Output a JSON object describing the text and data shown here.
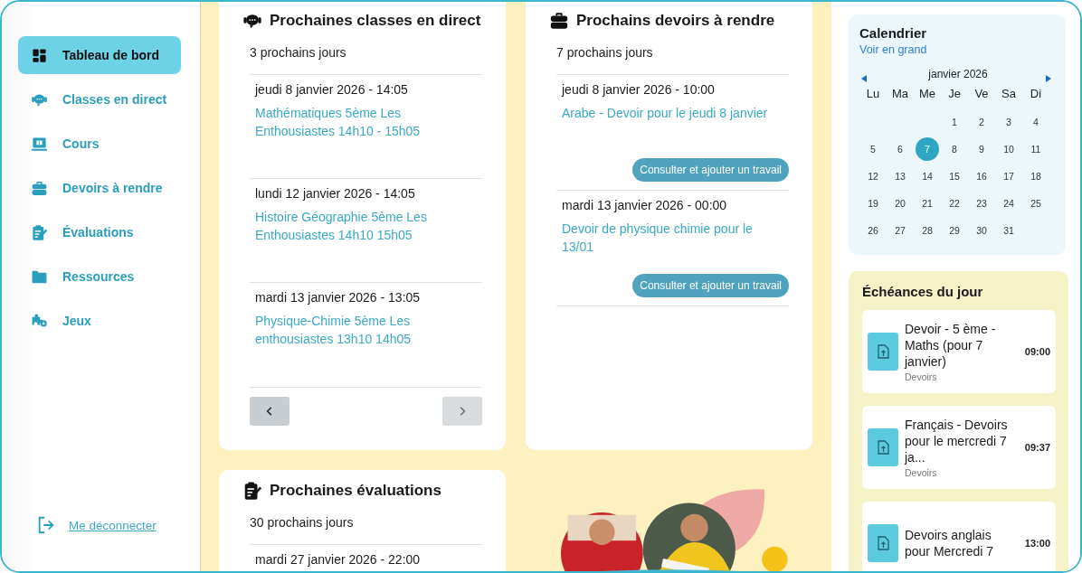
{
  "sidebar": {
    "items": [
      {
        "label": "Tableau de bord",
        "kind": "dashboard",
        "selected": true
      },
      {
        "label": "Classes en direct",
        "kind": "live",
        "selected": false
      },
      {
        "label": "Cours",
        "kind": "courses",
        "selected": false
      },
      {
        "label": "Devoirs à rendre",
        "kind": "homework",
        "selected": false
      },
      {
        "label": "Évaluations",
        "kind": "evaluations",
        "selected": false
      },
      {
        "label": "Ressources",
        "kind": "resources",
        "selected": false
      },
      {
        "label": "Jeux",
        "kind": "games",
        "selected": false
      }
    ],
    "logout": "Me déconnecter"
  },
  "panels": [
    {
      "title": "Prochaines classes en direct",
      "kind": "live",
      "period": "3 prochains jours",
      "entries": [
        {
          "date": "jeudi 8 janvier 2026 - 14:05",
          "link": "Mathématiques 5ème Les Enthousiastes 14h10 - 15h05"
        },
        {
          "date": "lundi 12 janvier 2026 - 14:05",
          "link": "Histoire Géographie 5ème Les Enthousiastes 14h10 15h05"
        },
        {
          "date": "mardi 13 janvier 2026 - 13:05",
          "link": "Physique-Chimie 5ème Les enthousiastes 13h10 14h05"
        }
      ]
    },
    {
      "title": "Prochains devoirs à rendre",
      "kind": "homework",
      "period": "7 prochains jours",
      "entries": [
        {
          "date": "jeudi 8 janvier 2026 - 10:00",
          "link": "Arabe - Devoir pour le jeudi 8 janvier",
          "button": "Consulter et ajouter un travail"
        },
        {
          "date": "mardi 13 janvier 2026 - 00:00",
          "link": "Devoir de physique chimie pour le 13/01",
          "button": "Consulter et ajouter un travail"
        }
      ]
    },
    {
      "title": "Prochaines évaluations",
      "kind": "evaluations",
      "period": "30 prochains jours",
      "entries": [
        {
          "date": "mardi 27 janvier 2026 - 22:00"
        }
      ]
    }
  ],
  "calendar": {
    "title": "Calendrier",
    "link": "Voir en grand",
    "month": "janvier 2026",
    "weekdays": [
      "Lu",
      "Ma",
      "Me",
      "Je",
      "Ve",
      "Sa",
      "Di"
    ],
    "weeks": [
      [
        {
          "day": "1",
          "selected": false
        },
        {
          "day": "2",
          "selected": false
        },
        {
          "day": "3",
          "selected": false
        },
        {
          "day": "4",
          "selected": false
        }
      ],
      [
        {
          "day": "5",
          "selected": false
        },
        {
          "day": "6",
          "selected": false
        },
        {
          "day": "7",
          "selected": true
        },
        {
          "day": "8",
          "selected": false
        },
        {
          "day": "9",
          "selected": false
        },
        {
          "day": "10",
          "selected": false
        },
        {
          "day": "11",
          "selected": false
        }
      ],
      [
        {
          "day": "12",
          "selected": false
        },
        {
          "day": "13",
          "selected": false
        },
        {
          "day": "14",
          "selected": false
        },
        {
          "day": "15",
          "selected": false
        },
        {
          "day": "16",
          "selected": false
        },
        {
          "day": "17",
          "selected": false
        },
        {
          "day": "18",
          "selected": false
        }
      ],
      [
        {
          "day": "19",
          "selected": false
        },
        {
          "day": "20",
          "selected": false
        },
        {
          "day": "21",
          "selected": false
        },
        {
          "day": "22",
          "selected": false
        },
        {
          "day": "23",
          "selected": false
        },
        {
          "day": "24",
          "selected": false
        },
        {
          "day": "25",
          "selected": false
        }
      ],
      [
        {
          "day": "26",
          "selected": false
        },
        {
          "day": "27",
          "selected": false
        },
        {
          "day": "28",
          "selected": false
        },
        {
          "day": "29",
          "selected": false
        },
        {
          "day": "30",
          "selected": false
        },
        {
          "day": "31",
          "selected": false
        }
      ]
    ]
  },
  "deadlines": {
    "title": "Échéances du jour",
    "items": [
      {
        "title": "Devoir - 5 ème - Maths (pour 7 janvier)",
        "category": "Devoirs",
        "time": "09:00"
      },
      {
        "title": "Français - Devoirs pour le mercredi 7 ja...",
        "category": "Devoirs",
        "time": "09:37"
      },
      {
        "title": "Devoirs anglais pour Mercredi 7",
        "time": "13:00"
      }
    ]
  }
}
